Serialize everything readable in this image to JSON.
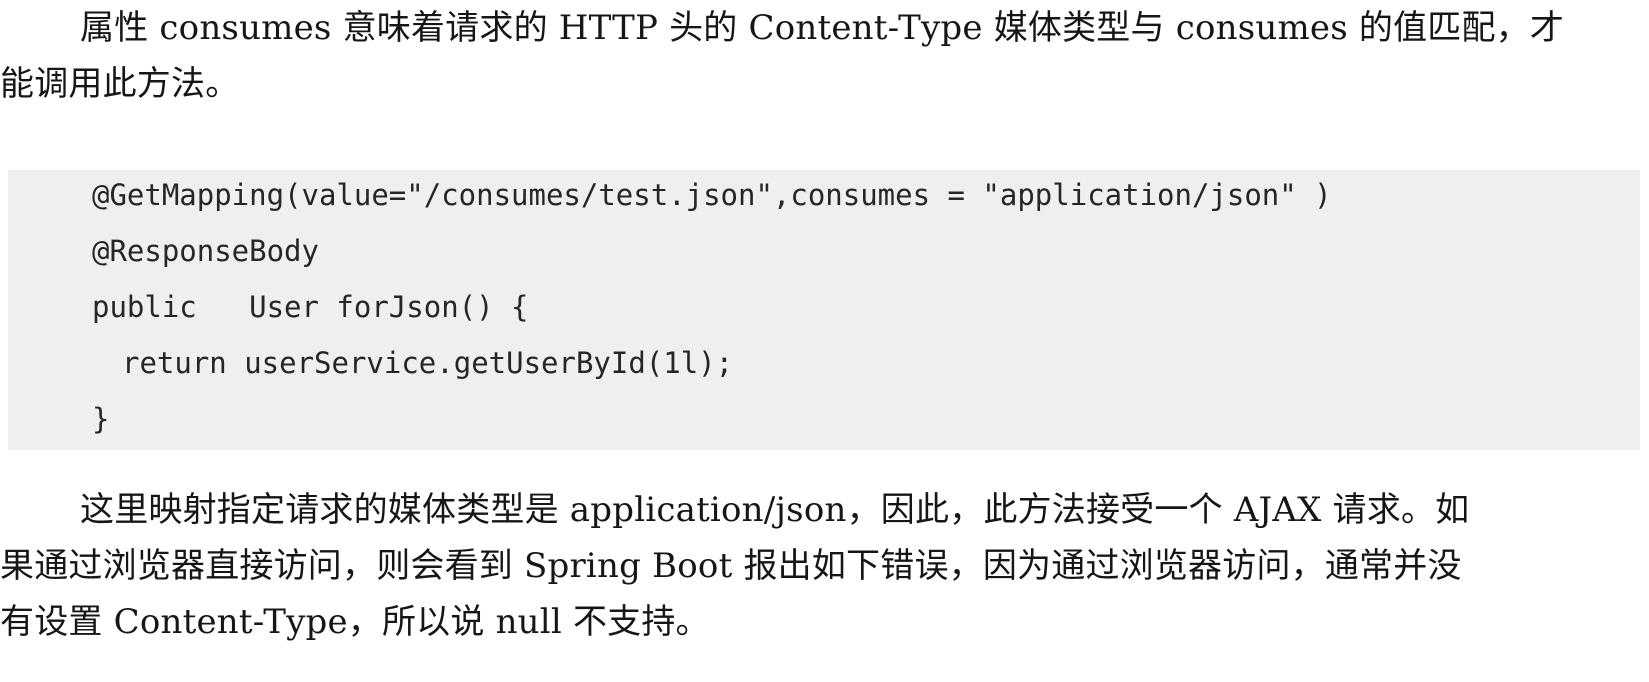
{
  "paragraph_1": {
    "lines": [
      "属性 consumes 意味着请求的 HTTP 头的 Content-Type 媒体类型与 consumes 的值匹配，才",
      "能调用此方法。"
    ]
  },
  "code": {
    "lines": [
      "@GetMapping(value=\"/consumes/test.json\",consumes = \"application/json\" )",
      "@ResponseBody",
      "public   User forJson() {",
      "return userService.getUserById(1l);",
      "}"
    ]
  },
  "paragraph_2": {
    "lines": [
      "这里映射指定请求的媒体类型是 application/json，因此，此方法接受一个 AJAX 请求。如",
      "果通过浏览器直接访问，则会看到 Spring Boot 报出如下错误，因为通过浏览器访问，通常并没",
      "有设置 Content-Type，所以说 null 不支持。"
    ]
  }
}
